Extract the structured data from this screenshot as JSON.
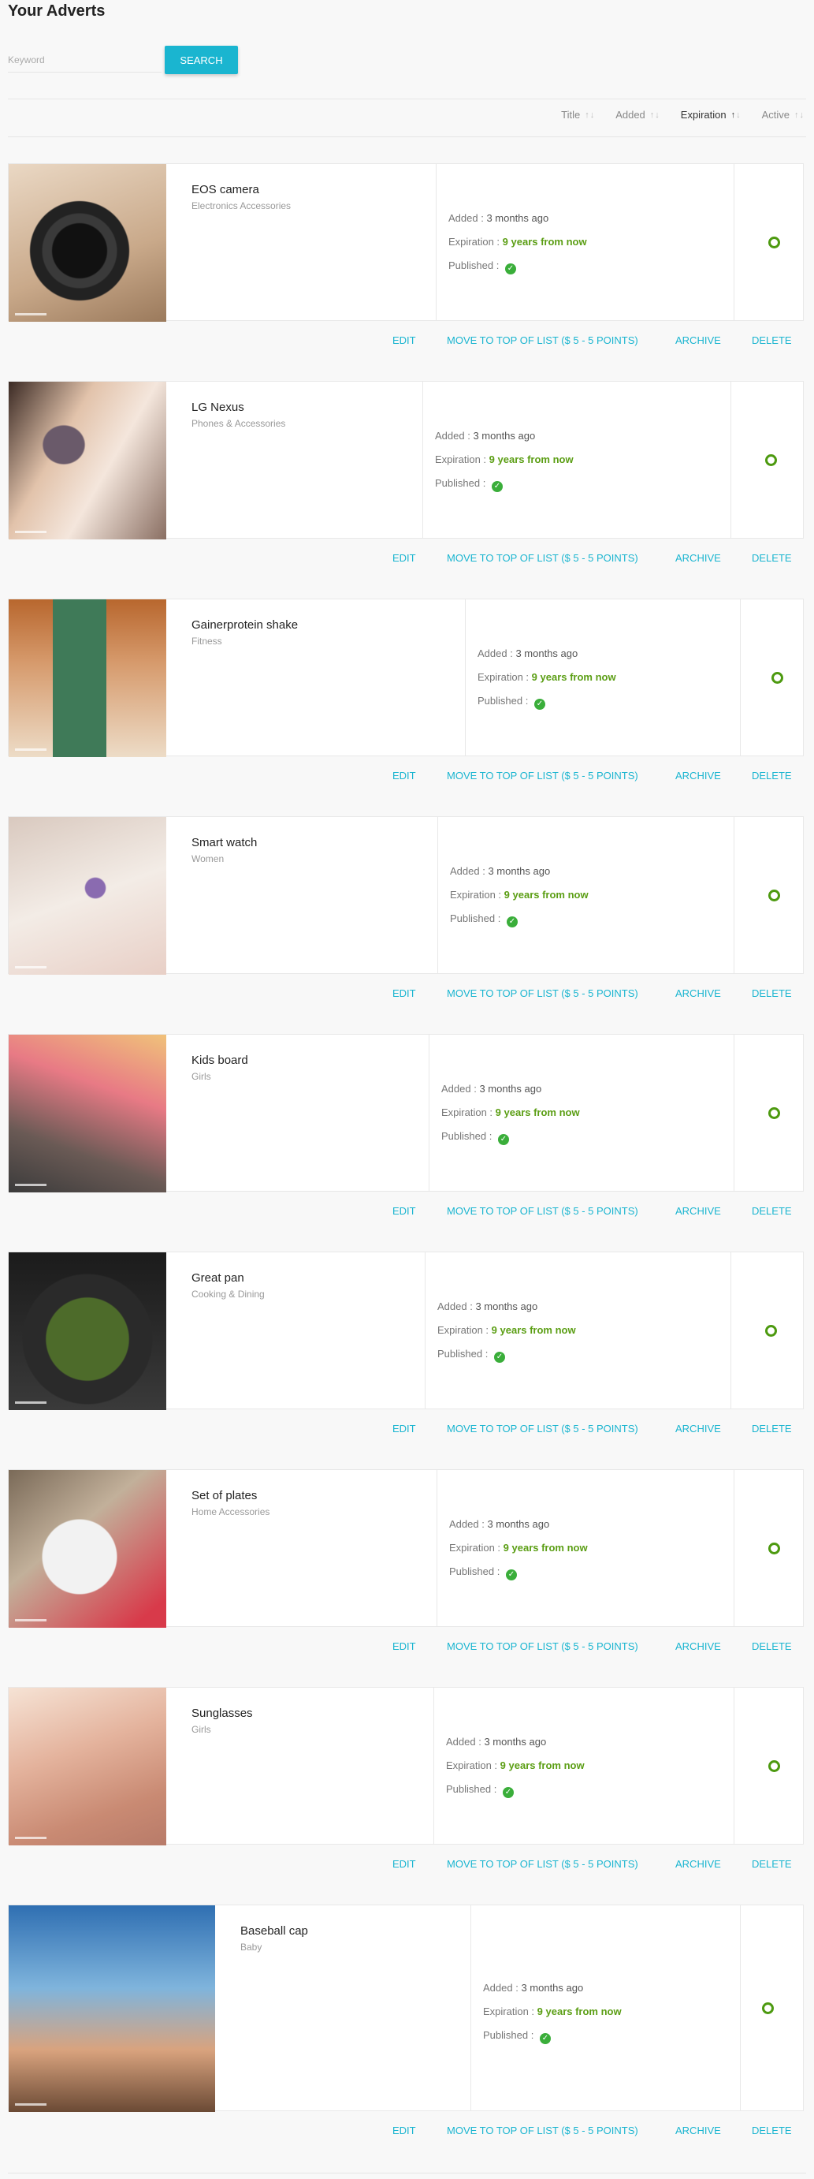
{
  "page": {
    "title": "Your Adverts"
  },
  "search": {
    "placeholder": "Keyword",
    "button_label": "SEARCH"
  },
  "sort": [
    {
      "label": "Title",
      "arrows": "↑↓",
      "active": false
    },
    {
      "label": "Added",
      "arrows": "↑↓",
      "active": false
    },
    {
      "label": "Expiration",
      "arrows": "↑↓",
      "active": true
    },
    {
      "label": "Active",
      "arrows": "↑↓",
      "active": false
    }
  ],
  "labels": {
    "added": "Added : ",
    "expiration": "Expiration : ",
    "published": "Published : "
  },
  "actions": {
    "edit": "EDIT",
    "move_to_top": "MOVE TO TOP OF LIST ($ 5 - 5 POINTS)",
    "archive": "ARCHIVE",
    "delete": "DELETE"
  },
  "colors": {
    "accent": "#1ab5d0",
    "expiration": "#5b9e14",
    "active": "#4d9a10",
    "published": "#3aae3a"
  },
  "adverts": [
    {
      "title": "EOS camera",
      "category": "Electronics Accessories",
      "added": "3 months ago",
      "expiration": "9 years from now",
      "published": true,
      "active": true,
      "image": "camera"
    },
    {
      "title": "LG Nexus",
      "category": "Phones & Accessories",
      "added": "3 months ago",
      "expiration": "9 years from now",
      "published": true,
      "active": true,
      "image": "phone"
    },
    {
      "title": "Gainerprotein shake",
      "category": "Fitness",
      "added": "3 months ago",
      "expiration": "9 years from now",
      "published": true,
      "active": true,
      "image": "shaker"
    },
    {
      "title": "Smart watch",
      "category": "Women",
      "added": "3 months ago",
      "expiration": "9 years from now",
      "published": true,
      "active": true,
      "image": "watch"
    },
    {
      "title": "Kids board",
      "category": "Girls",
      "added": "3 months ago",
      "expiration": "9 years from now",
      "published": true,
      "active": true,
      "image": "skateboard"
    },
    {
      "title": "Great pan",
      "category": "Cooking & Dining",
      "added": "3 months ago",
      "expiration": "9 years from now",
      "published": true,
      "active": true,
      "image": "pan"
    },
    {
      "title": "Set of plates",
      "category": "Home Accessories",
      "added": "3 months ago",
      "expiration": "9 years from now",
      "published": true,
      "active": true,
      "image": "plates"
    },
    {
      "title": "Sunglasses",
      "category": "Girls",
      "added": "3 months ago",
      "expiration": "9 years from now",
      "published": true,
      "active": true,
      "image": "sunglasses"
    },
    {
      "title": "Baseball cap",
      "category": "Baby",
      "added": "3 months ago",
      "expiration": "9 years from now",
      "published": true,
      "active": true,
      "image": "cap"
    }
  ]
}
